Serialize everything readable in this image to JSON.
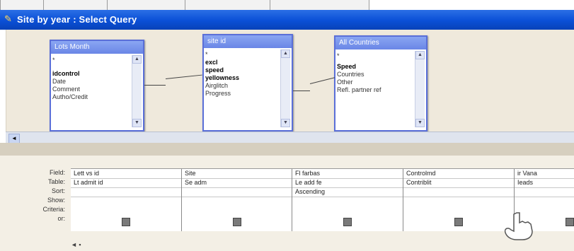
{
  "window": {
    "title": "Site by year : Select Query"
  },
  "colors": {
    "titlebar": "#0a4fd6",
    "table_border": "#5a6fd8",
    "design_bg": "#efe9dc",
    "grid_bg": "#f3efe5"
  },
  "tables": [
    {
      "header": "Lots Month",
      "fields": [
        "*",
        "idcontrol",
        "Date",
        "Comment",
        "Autho/Credit"
      ],
      "bold": [
        false,
        true,
        false,
        false,
        false
      ]
    },
    {
      "header": "site id",
      "fields": [
        "*",
        "excl",
        "speed",
        "yellowness",
        "Airglitch",
        "Progress"
      ],
      "bold": [
        false,
        true,
        true,
        true,
        false,
        false
      ]
    },
    {
      "header": "All Countries",
      "fields": [
        "*",
        "Speed",
        "Countries",
        "Other",
        "Refl. partner ref"
      ],
      "bold": [
        false,
        true,
        false,
        false,
        false
      ]
    }
  ],
  "grid": {
    "row_labels": [
      "Field:",
      "Table:",
      "Sort:",
      "Show:",
      "Criteria:",
      "or:"
    ],
    "columns": [
      {
        "field": "Lett vs id",
        "table": "Lt admit id",
        "sort": ""
      },
      {
        "field": "Site",
        "table": "Se adm",
        "sort": ""
      },
      {
        "field": "Fl farbas",
        "table": "Le add fe",
        "sort": "Ascending"
      },
      {
        "field": "Controlmd",
        "table": "Contriblit",
        "sort": ""
      },
      {
        "field": "ir Vana",
        "table": "Ieads",
        "sort": ""
      }
    ],
    "show_checked": [
      true,
      true,
      true,
      true,
      true
    ]
  }
}
